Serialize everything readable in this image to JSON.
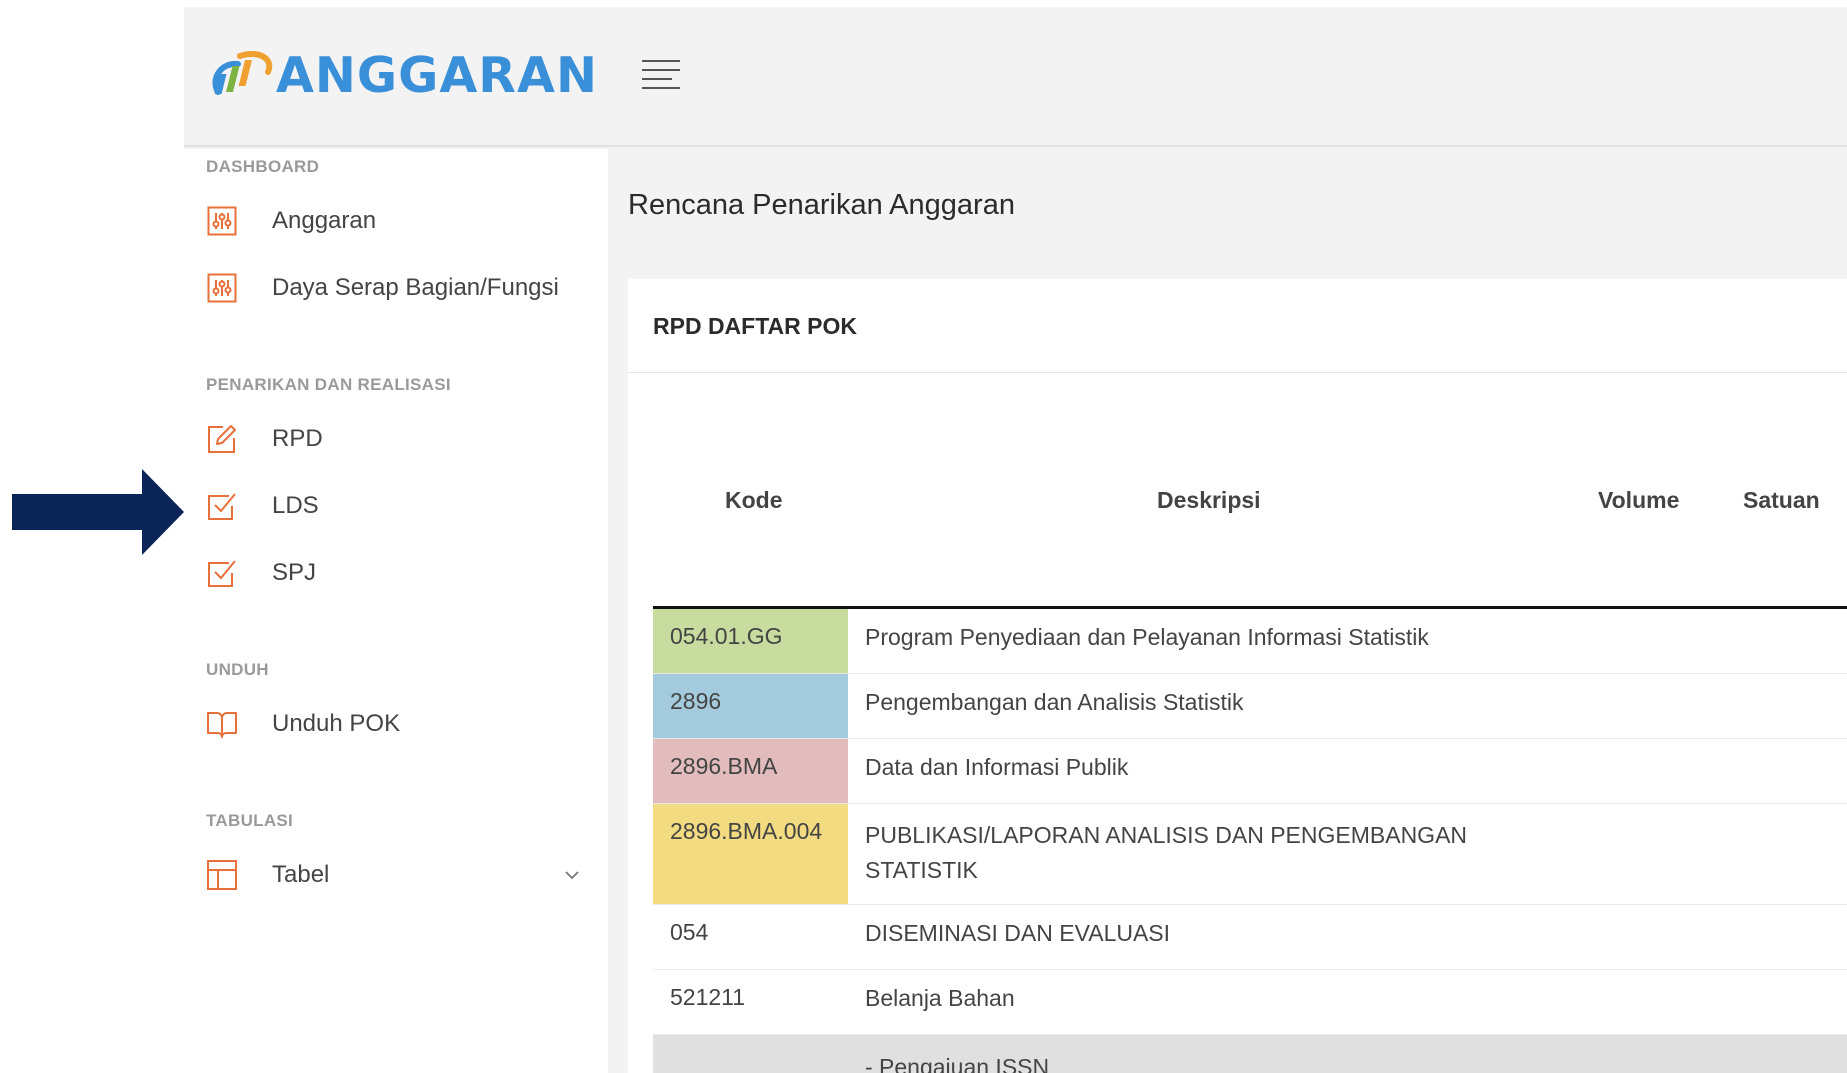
{
  "app": {
    "title": "ANGGARAN",
    "menu_icon": "hamburger-icon"
  },
  "sidebar": {
    "sections": [
      {
        "title": "DASHBOARD",
        "items": [
          {
            "label": "Anggaran",
            "icon": "sliders-icon"
          },
          {
            "label": "Daya Serap Bagian/Fungsi",
            "icon": "sliders-icon"
          }
        ]
      },
      {
        "title": "PENARIKAN DAN REALISASI",
        "items": [
          {
            "label": "RPD",
            "icon": "edit-icon"
          },
          {
            "label": "LDS",
            "icon": "check-square-icon"
          },
          {
            "label": "SPJ",
            "icon": "check-square-icon"
          }
        ]
      },
      {
        "title": "UNDUH",
        "items": [
          {
            "label": "Unduh POK",
            "icon": "book-icon"
          }
        ]
      },
      {
        "title": "TABULASI",
        "items": [
          {
            "label": "Tabel",
            "icon": "layout-icon"
          }
        ]
      }
    ]
  },
  "main": {
    "page_title": "Rencana Penarikan Anggaran",
    "card_title": "RPD DAFTAR POK",
    "columns": [
      "Kode",
      "Deskripsi",
      "Volume",
      "Satuan"
    ],
    "rows": [
      {
        "kode": "054.01.GG",
        "deskripsi": "Program Penyediaan dan Pelayanan Informasi Statistik",
        "color": "#c9dca0"
      },
      {
        "kode": "2896",
        "deskripsi": "Pengembangan dan Analisis Statistik",
        "color": "#a4cbdd"
      },
      {
        "kode": "2896.BMA",
        "deskripsi": "Data dan Informasi Publik",
        "color": "#e2bcbc"
      },
      {
        "kode": "2896.BMA.004",
        "deskripsi": "PUBLIKASI/LAPORAN ANALISIS DAN PENGEMBANGAN STATISTIK",
        "color": "#f3db82"
      },
      {
        "kode": "054",
        "deskripsi": "DISEMINASI DAN EVALUASI",
        "color": ""
      },
      {
        "kode": "521211",
        "deskripsi": "Belanja Bahan",
        "color": ""
      },
      {
        "kode": "",
        "deskripsi": "- Pengajuan ISSN",
        "color": "#e0e0e0"
      }
    ]
  },
  "annotation": {
    "arrow_color": "#0b2558"
  }
}
